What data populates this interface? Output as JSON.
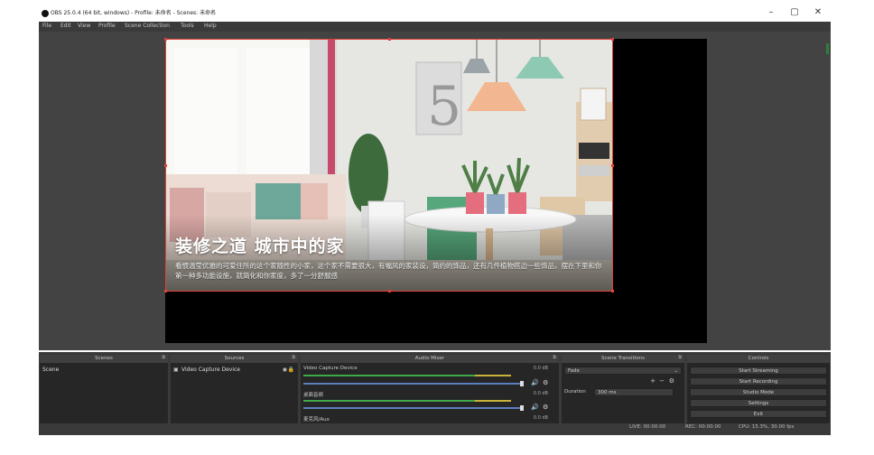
{
  "window": {
    "title": "OBS 25.0.4 (64 bit, windows) - Profile: 未命名 - Scenes: 未命名",
    "minimize": "–",
    "maximize": "▢",
    "close": "✕"
  },
  "menu": [
    "File",
    "Edit",
    "View",
    "Profile",
    "Scene Collection",
    "Tools",
    "Help"
  ],
  "preview": {
    "title": "装修之道 城市中的家",
    "body": "看惯温莹优雅的可爱住所的这个家随性的小家，这个家不需要很大，有幅风的家装设，简约的饰品，还有几件植物搭边一些饰品，摆在下里和你第一种多功能设施，就简化和你家度，多了一分舒服感"
  },
  "docks": {
    "scenes": {
      "title": "Scenes",
      "items": [
        "Scene"
      ],
      "toolbar": "+ − ⌃ ⌄"
    },
    "sources": {
      "title": "Sources",
      "items": [
        "Video Capture Device"
      ],
      "toolbar": "+ − ⚙ ⌃ ⌄"
    },
    "mixer": {
      "title": "Audio Mixer",
      "channels": [
        {
          "label": "Video Capture Device",
          "db": "0.0 dB"
        },
        {
          "label": "桌面音频",
          "db": "0.0 dB"
        },
        {
          "label": "麦克风/Aux",
          "db": "0.0 dB"
        }
      ]
    },
    "transitions": {
      "title": "Scene Transitions",
      "select": "Fade",
      "duration_label": "Duration",
      "duration_value": "300 ms"
    },
    "controls": {
      "title": "Controls",
      "buttons": [
        "Start Streaming",
        "Start Recording",
        "Studio Mode",
        "Settings",
        "Exit"
      ]
    }
  },
  "status": {
    "live": "LIVE: 00:00:00",
    "rec": "REC: 00:00:00",
    "cpu": "CPU: 15.3%, 30.00 fps"
  },
  "colors": {
    "handle": "#e0413a",
    "meter_green": "#3fa84a",
    "meter_yellow": "#c9b33a",
    "meter_red": "#c0392b",
    "fader": "#5b7fbf"
  }
}
